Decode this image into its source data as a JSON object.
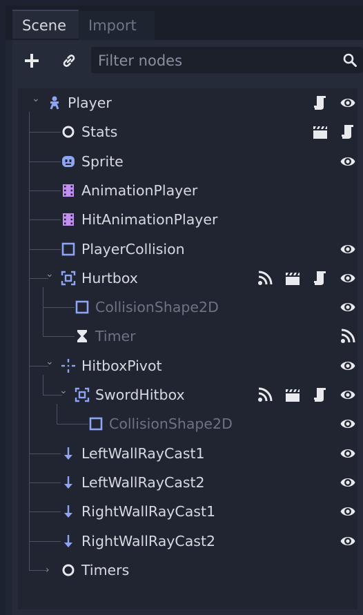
{
  "tabs": [
    {
      "label": "Scene",
      "active": true
    },
    {
      "label": "Import",
      "active": false
    }
  ],
  "toolbar": {
    "add_icon": "plus-icon",
    "link_icon": "link-icon",
    "filter_placeholder": "Filter nodes",
    "search_icon": "search-icon"
  },
  "tree": {
    "nodes": [
      {
        "label": "Player",
        "icon": "player-node-icon",
        "depth": 0,
        "expanded": true,
        "dimmed": false,
        "buttons": [
          "script-icon",
          "visibility-eye-icon"
        ]
      },
      {
        "label": "Stats",
        "icon": "node-circle-icon",
        "depth": 1,
        "dimmed": false,
        "buttons": [
          "instance-clapper-icon",
          "script-icon"
        ]
      },
      {
        "label": "Sprite",
        "icon": "sprite-icon",
        "depth": 1,
        "dimmed": false,
        "buttons": [
          "visibility-eye-icon"
        ]
      },
      {
        "label": "AnimationPlayer",
        "icon": "animation-player-icon",
        "depth": 1,
        "dimmed": false,
        "buttons": []
      },
      {
        "label": "HitAnimationPlayer",
        "icon": "animation-player-icon",
        "depth": 1,
        "dimmed": false,
        "buttons": []
      },
      {
        "label": "PlayerCollision",
        "icon": "collision-shape-icon",
        "depth": 1,
        "dimmed": false,
        "buttons": [
          "visibility-eye-icon"
        ]
      },
      {
        "label": "Hurtbox",
        "icon": "area2d-icon",
        "depth": 1,
        "expanded": true,
        "dimmed": false,
        "buttons": [
          "signal-icon",
          "instance-clapper-icon",
          "script-icon",
          "visibility-eye-icon"
        ]
      },
      {
        "label": "CollisionShape2D",
        "icon": "collision-shape-icon",
        "depth": 2,
        "dimmed": true,
        "buttons": [
          "visibility-eye-icon"
        ]
      },
      {
        "label": "Timer",
        "icon": "timer-hourglass-icon",
        "depth": 2,
        "dimmed": true,
        "buttons": [
          "signal-icon"
        ]
      },
      {
        "label": "HitboxPivot",
        "icon": "position2d-icon",
        "depth": 1,
        "expanded": true,
        "dimmed": false,
        "buttons": [
          "visibility-eye-icon"
        ]
      },
      {
        "label": "SwordHitbox",
        "icon": "area2d-icon",
        "depth": 2,
        "expanded": true,
        "dimmed": false,
        "buttons": [
          "signal-icon",
          "instance-clapper-icon",
          "script-icon",
          "visibility-eye-icon"
        ]
      },
      {
        "label": "CollisionShape2D",
        "icon": "collision-shape-icon",
        "depth": 3,
        "dimmed": true,
        "buttons": [
          "visibility-eye-icon"
        ]
      },
      {
        "label": "LeftWallRayCast1",
        "icon": "raycast-arrow-icon",
        "depth": 1,
        "dimmed": false,
        "buttons": [
          "visibility-eye-icon"
        ]
      },
      {
        "label": "LeftWallRayCast2",
        "icon": "raycast-arrow-icon",
        "depth": 1,
        "dimmed": false,
        "buttons": [
          "visibility-eye-icon"
        ]
      },
      {
        "label": "RightWallRayCast1",
        "icon": "raycast-arrow-icon",
        "depth": 1,
        "dimmed": false,
        "buttons": [
          "visibility-eye-icon"
        ]
      },
      {
        "label": "RightWallRayCast2",
        "icon": "raycast-arrow-icon",
        "depth": 1,
        "dimmed": false,
        "buttons": [
          "visibility-eye-icon"
        ]
      },
      {
        "label": "Timers",
        "icon": "node-circle-icon",
        "depth": 1,
        "expanded": false,
        "dimmed": false,
        "buttons": []
      }
    ]
  },
  "colors": {
    "background": "#202633",
    "panel": "#252b38",
    "text": "#d6d9df",
    "dim_text": "#6d7384",
    "node2d_blue": "#8da5f3",
    "animation_purple": "#c38ef1",
    "icon_white": "#e8eaee"
  }
}
